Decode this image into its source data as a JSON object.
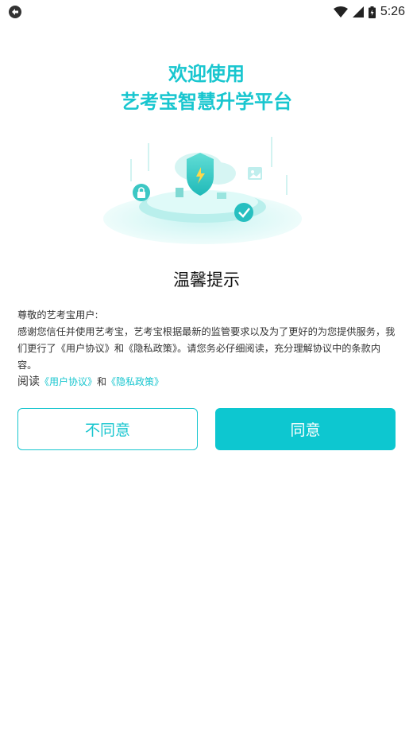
{
  "status_bar": {
    "time": "5:26",
    "left_icon": "sync-icon",
    "right_icons": [
      "wifi-icon",
      "signal-icon",
      "battery-icon"
    ]
  },
  "welcome": {
    "line1": "欢迎使用",
    "line2": "艺考宝智慧升学平台"
  },
  "hero": {
    "icon": "security-shield-illustration"
  },
  "dialog": {
    "title": "温馨提示",
    "greeting": "尊敬的艺考宝用户:",
    "body1": "感谢您信任并使用艺考宝，艺考宝根据最新的监管要求以及为了更好的为您提供服务，我们更行了《用户协议》和《隐私政策》。请您务必仔细阅读，充分理解协议中的条款内容。",
    "read_label": "阅读",
    "user_agreement_link": "《用户协议》",
    "and_text": "和",
    "privacy_policy_link": "《隐私政策》"
  },
  "buttons": {
    "disagree": "不同意",
    "agree": "同意"
  },
  "colors": {
    "accent": "#18c6cf",
    "button_fill": "#0dc7d0"
  }
}
